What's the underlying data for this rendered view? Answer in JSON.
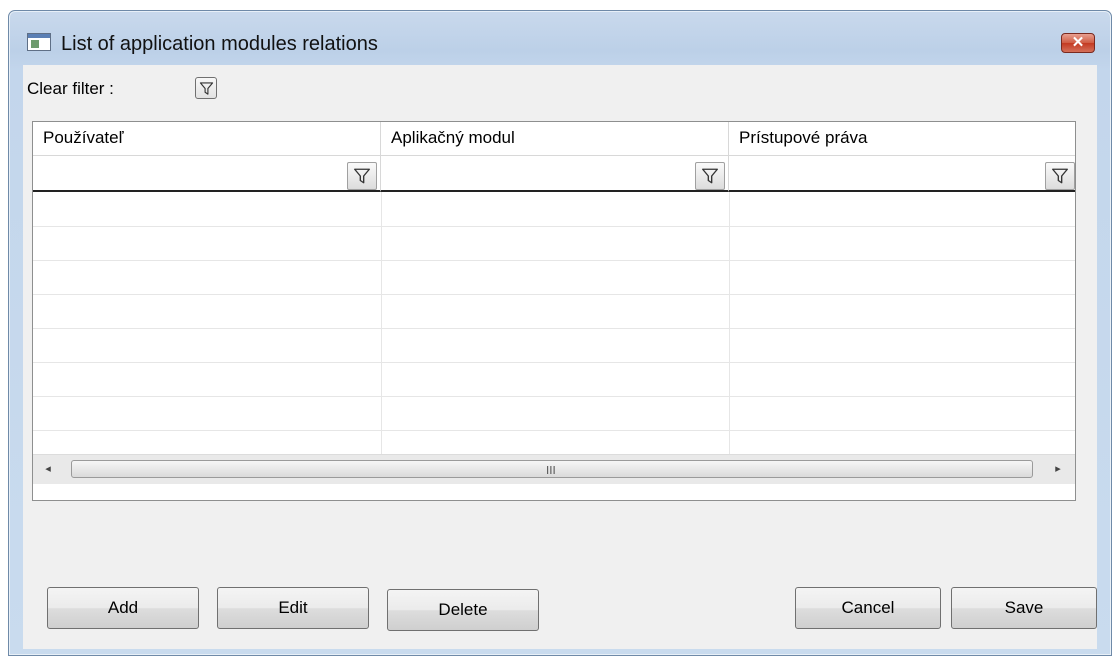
{
  "window": {
    "title": "List of application modules relations",
    "close_glyph": "✕",
    "icon": "window-app-icon"
  },
  "filter_bar": {
    "clear_filter_label": "Clear filter :",
    "icon": "filter-icon"
  },
  "grid": {
    "columns": [
      {
        "header": "Používateľ",
        "filter_value": ""
      },
      {
        "header": "Aplikačný modul",
        "filter_value": ""
      },
      {
        "header": "Prístupové práva",
        "filter_value": ""
      }
    ],
    "rows": [],
    "scrollbar": {
      "left_arrow": "◂",
      "right_arrow": "▸",
      "grip": "III"
    }
  },
  "buttons": {
    "add": "Add",
    "edit": "Edit",
    "delete": "Delete",
    "cancel": "Cancel",
    "save": "Save"
  },
  "colors": {
    "frame": "#c9d9ec",
    "close_button": "#c43a22",
    "client_background": "#f0f0f0"
  }
}
